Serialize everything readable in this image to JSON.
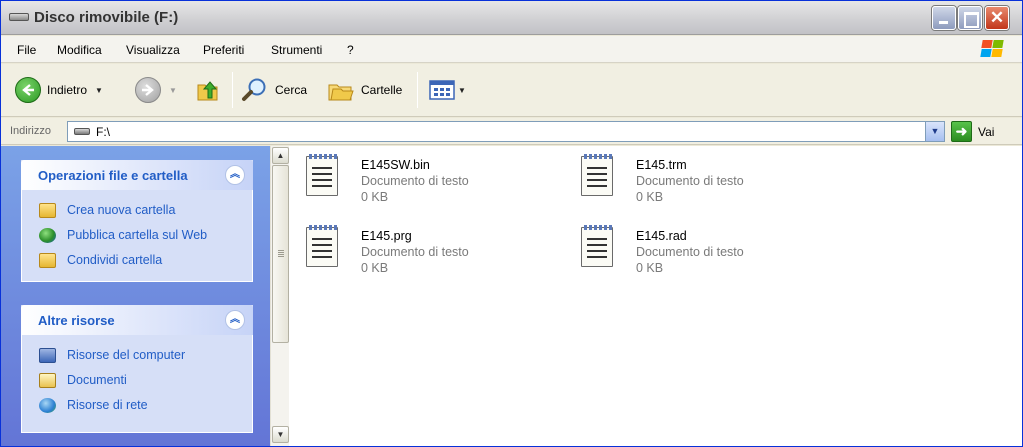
{
  "window": {
    "title": "Disco rimovibile (F:)",
    "close_glyph": "✕"
  },
  "menu": [
    "File",
    "Modifica",
    "Visualizza",
    "Preferiti",
    "Strumenti",
    "?"
  ],
  "toolbar": {
    "back_label": "Indietro",
    "search_label": "Cerca",
    "folders_label": "Cartelle",
    "back_icon": "back-arrow-icon",
    "forward_icon": "forward-arrow-icon",
    "up_icon": "folder-up-icon",
    "search_icon": "magnifier-icon",
    "folders_icon": "folders-icon",
    "views_icon": "views-icon"
  },
  "address": {
    "label": "Indirizzo",
    "value": "F:\\",
    "go_label": "Vai"
  },
  "tasks_panel": {
    "title": "Operazioni file e cartella",
    "items": [
      {
        "label": "Crea nuova cartella",
        "icon": "new-folder-icon"
      },
      {
        "label": "Pubblica cartella sul Web",
        "icon": "globe-icon"
      },
      {
        "label": "Condividi cartella",
        "icon": "share-folder-icon"
      }
    ]
  },
  "places_panel": {
    "title": "Altre risorse",
    "items": [
      {
        "label": "Risorse del computer",
        "icon": "computer-icon"
      },
      {
        "label": "Documenti",
        "icon": "documents-icon"
      },
      {
        "label": "Risorse di rete",
        "icon": "network-icon"
      }
    ]
  },
  "files": [
    {
      "name": "E145SW.bin",
      "type": "Documento di testo",
      "size": "0 KB"
    },
    {
      "name": "E145.trm",
      "type": "Documento di testo",
      "size": "0 KB"
    },
    {
      "name": "E145.prg",
      "type": "Documento di testo",
      "size": "0 KB"
    },
    {
      "name": "E145.rad",
      "type": "Documento di testo",
      "size": "0 KB"
    }
  ],
  "colors": {
    "accent": "#215dc6",
    "titlebar_close": "#c2361a",
    "pane_bg": "#6f8fe0"
  }
}
